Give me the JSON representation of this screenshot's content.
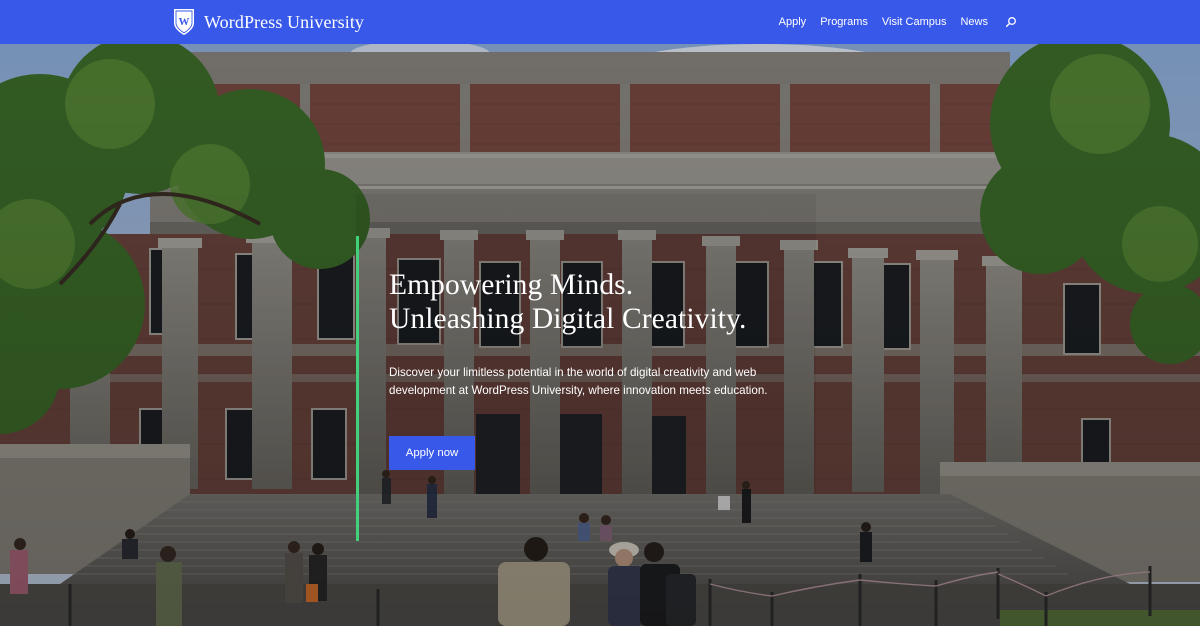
{
  "site": {
    "name": "WordPress University"
  },
  "nav": {
    "items": [
      "Apply",
      "Programs",
      "Visit Campus",
      "News"
    ]
  },
  "hero": {
    "headline_line1": "Empowering Minds.",
    "headline_line2": "Unleashing Digital Creativity.",
    "subtext": "Discover your limitless potential in the world of digital creativity and web development at WordPress University, where innovation meets education.",
    "cta_label": "Apply now"
  },
  "colors": {
    "brand": "#3858e9",
    "accent": "#43d07a",
    "text": "#ffffff"
  },
  "icons": {
    "logo": "shield-w-icon",
    "search": "search-icon"
  }
}
